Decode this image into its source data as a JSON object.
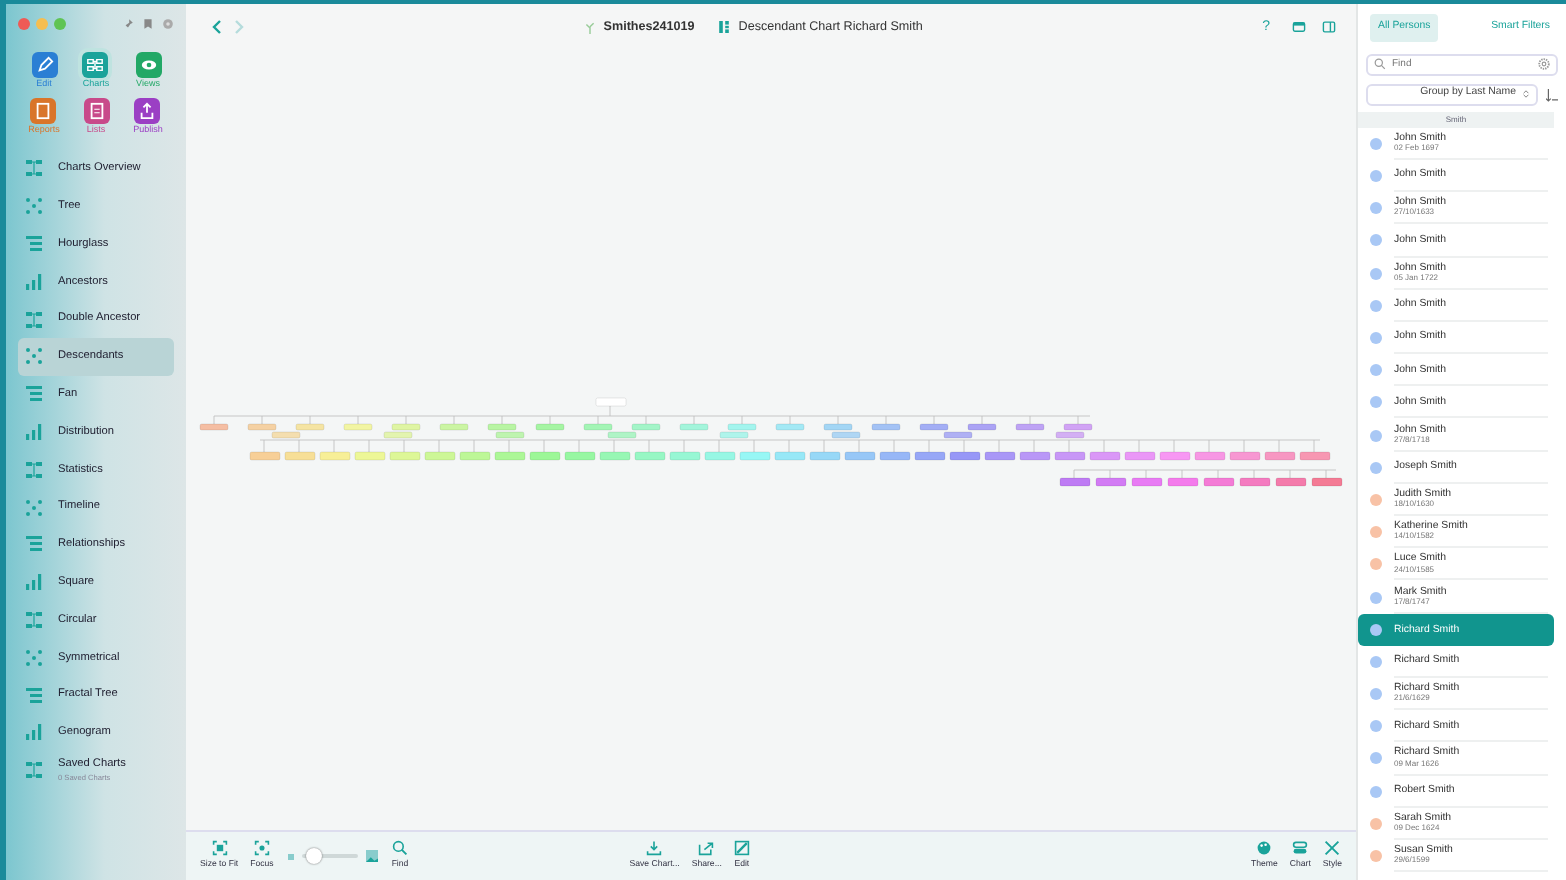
{
  "sidebar": {
    "tiles": [
      {
        "label": "Edit",
        "color": "#2a7fd4",
        "selected": false
      },
      {
        "label": "Charts",
        "color": "#1aa39a",
        "selected": true
      },
      {
        "label": "Views",
        "color": "#22a866",
        "selected": false
      },
      {
        "label": "Reports",
        "color": "#d9752a",
        "selected": false
      },
      {
        "label": "Lists",
        "color": "#c84a8a",
        "selected": false
      },
      {
        "label": "Publish",
        "color": "#9b3fc4",
        "selected": false
      }
    ],
    "items": [
      {
        "label": "Charts Overview",
        "selected": false
      },
      {
        "label": "Tree",
        "selected": false
      },
      {
        "label": "Hourglass",
        "selected": false
      },
      {
        "label": "Ancestors",
        "selected": false
      },
      {
        "label": "Double Ancestor",
        "selected": false
      },
      {
        "label": "Descendants",
        "selected": true
      },
      {
        "label": "Fan",
        "selected": false
      },
      {
        "label": "Distribution",
        "selected": false
      },
      {
        "label": "Statistics",
        "selected": false
      },
      {
        "label": "Timeline",
        "selected": false
      },
      {
        "label": "Relationships",
        "selected": false
      },
      {
        "label": "Square",
        "selected": false
      },
      {
        "label": "Circular",
        "selected": false
      },
      {
        "label": "Symmetrical",
        "selected": false
      },
      {
        "label": "Fractal Tree",
        "selected": false
      },
      {
        "label": "Genogram",
        "selected": false
      },
      {
        "label": "Saved Charts",
        "subtitle": "0 Saved Charts",
        "selected": false
      }
    ]
  },
  "header": {
    "back_disabled": false,
    "forward_disabled": true,
    "database": "Smithes241019",
    "chart_title": "Descendant Chart Richard Smith",
    "help": "?"
  },
  "toolbar": {
    "left": [
      "Size to Fit",
      "Focus"
    ],
    "zoom": {
      "level": 0.1
    },
    "find": "Find",
    "center": [
      "Save Chart...",
      "Share...",
      "Edit"
    ],
    "right": [
      "Theme",
      "Chart",
      "Style"
    ]
  },
  "persons": {
    "tabs": [
      {
        "label": "All Persons",
        "selected": true
      },
      {
        "label": "Smart Filters",
        "selected": false
      }
    ],
    "search": {
      "placeholder": "Find"
    },
    "group_by": "Group by Last Name",
    "section": "Smith",
    "list": [
      {
        "name": "John Smith",
        "date": "02 Feb 1697",
        "color": "#a9c8f5",
        "selected": false
      },
      {
        "name": "John Smith",
        "color": "#a9c8f5",
        "selected": false
      },
      {
        "name": "John Smith",
        "date": "27/10/1633",
        "color": "#a9c8f5",
        "selected": false
      },
      {
        "name": "John Smith",
        "color": "#a9c8f5",
        "selected": false
      },
      {
        "name": "John Smith",
        "date": "05 Jan 1722",
        "color": "#a9c8f5",
        "selected": false
      },
      {
        "name": "John Smith",
        "color": "#a9c8f5",
        "selected": false
      },
      {
        "name": "John Smith",
        "color": "#a9c8f5",
        "selected": false
      },
      {
        "name": "John Smith",
        "color": "#a9c8f5",
        "selected": false
      },
      {
        "name": "John Smith",
        "color": "#a9c8f5",
        "selected": false
      },
      {
        "name": "John Smith",
        "date": "27/8/1718",
        "color": "#a9c8f5",
        "selected": false
      },
      {
        "name": "Joseph Smith",
        "color": "#a9c8f5",
        "selected": false
      },
      {
        "name": "Judith Smith",
        "date": "18/10/1630",
        "color": "#f8c2a6",
        "selected": false
      },
      {
        "name": "Katherine Smith",
        "date": "14/10/1582",
        "color": "#f8c2a6",
        "selected": false
      },
      {
        "name": "Luce Smith",
        "date": "24/10/1585",
        "color": "#f8c2a6",
        "selected": false
      },
      {
        "name": "Mark Smith",
        "date": "17/8/1747",
        "color": "#a9c8f5",
        "selected": false
      },
      {
        "name": "Richard Smith",
        "color": "#a9c8f5",
        "selected": true
      },
      {
        "name": "Richard Smith",
        "color": "#a9c8f5",
        "selected": false
      },
      {
        "name": "Richard Smith",
        "date": "21/6/1629",
        "color": "#a9c8f5",
        "selected": false
      },
      {
        "name": "Richard Smith",
        "color": "#a9c8f5",
        "selected": false
      },
      {
        "name": "Richard Smith",
        "date": "09 Mar 1626",
        "color": "#a9c8f5",
        "selected": false
      },
      {
        "name": "Robert Smith",
        "color": "#a9c8f5",
        "selected": false
      },
      {
        "name": "Sarah Smith",
        "date": "09 Dec 1624",
        "color": "#f8c2a6",
        "selected": false
      },
      {
        "name": "Susan Smith",
        "date": "29/6/1599",
        "color": "#f8c2a6",
        "selected": false
      }
    ]
  }
}
